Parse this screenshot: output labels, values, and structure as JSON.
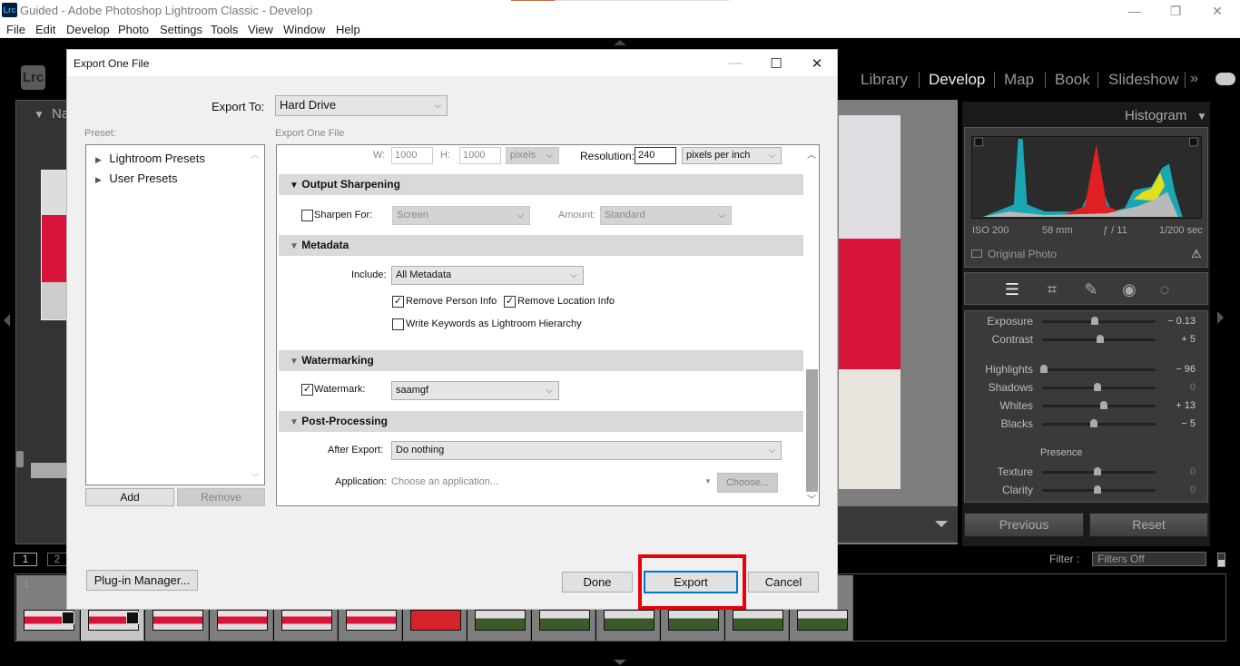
{
  "window": {
    "title": "Guided - Adobe Photoshop Lightroom Classic - Develop",
    "app_icon": "Lrc",
    "minimize": "—",
    "restore": "❐",
    "close": "✕"
  },
  "menubar": [
    "File",
    "Edit",
    "Develop",
    "Photo",
    "Settings",
    "Tools",
    "View",
    "Window",
    "Help"
  ],
  "lightroom": {
    "logo": "Lrc",
    "modules": [
      "Library",
      "Develop",
      "Map",
      "Book",
      "Slideshow"
    ],
    "active_module": "Develop",
    "more_modules": "»",
    "left_panel_header": "Na",
    "right_panel": {
      "histogram_title": "Histogram",
      "exif": {
        "iso": "ISO 200",
        "focal": "58 mm",
        "aperture": "ƒ / 11",
        "shutter": "1/200 sec"
      },
      "original_photo": "Original Photo",
      "sliders": [
        {
          "label": "Exposure",
          "value": "− 0.13",
          "position": 0.48
        },
        {
          "label": "Contrast",
          "value": "+ 5",
          "position": 0.53
        },
        {
          "label": "Highlights",
          "value": "− 96",
          "position": 0.02
        },
        {
          "label": "Shadows",
          "value": "0",
          "position": 0.5
        },
        {
          "label": "Whites",
          "value": "+ 13",
          "position": 0.56
        },
        {
          "label": "Blacks",
          "value": "− 5",
          "position": 0.47
        },
        {
          "label": "Texture",
          "value": "0",
          "position": 0.5
        },
        {
          "label": "Clarity",
          "value": "0",
          "position": 0.5
        }
      ],
      "presence_label": "Presence",
      "previous_button": "Previous",
      "reset_button": "Reset"
    },
    "filmstrip": {
      "filter_label": "Filter :",
      "filter_value": "Filters Off",
      "view_1": "1",
      "view_2": "2",
      "first_index": "1"
    }
  },
  "dialog": {
    "title": "Export One File",
    "export_to_label": "Export To:",
    "export_to_value": "Hard Drive",
    "preset_label": "Preset:",
    "presets": [
      "Lightroom Presets",
      "User Presets"
    ],
    "add_button": "Add",
    "remove_button": "Remove",
    "plugin_manager_button": "Plug-in Manager...",
    "main_label": "Export One File",
    "image_sizing": {
      "w_label": "W:",
      "w_value": "1000",
      "h_label": "H:",
      "h_value": "1000",
      "units": "pixels",
      "resolution_label": "Resolution:",
      "resolution_value": "240",
      "resolution_units": "pixels per inch"
    },
    "output_sharpening": {
      "title": "Output Sharpening",
      "sharpen_for_label": "Sharpen For:",
      "sharpen_for_checked": false,
      "sharpen_for_value": "Screen",
      "amount_label": "Amount:",
      "amount_value": "Standard"
    },
    "metadata": {
      "title": "Metadata",
      "include_label": "Include:",
      "include_value": "All Metadata",
      "remove_person_label": "Remove Person Info",
      "remove_person_checked": true,
      "remove_location_label": "Remove Location Info",
      "remove_location_checked": true,
      "write_keywords_label": "Write Keywords as Lightroom Hierarchy",
      "write_keywords_checked": false
    },
    "watermarking": {
      "title": "Watermarking",
      "watermark_label": "Watermark:",
      "watermark_checked": true,
      "watermark_value": "saamgf"
    },
    "post_processing": {
      "title": "Post-Processing",
      "after_export_label": "After Export:",
      "after_export_value": "Do nothing",
      "application_label": "Application:",
      "application_placeholder": "Choose an application...",
      "choose_button": "Choose..."
    },
    "done_button": "Done",
    "export_button": "Export",
    "cancel_button": "Cancel"
  },
  "check_mark": "✓"
}
